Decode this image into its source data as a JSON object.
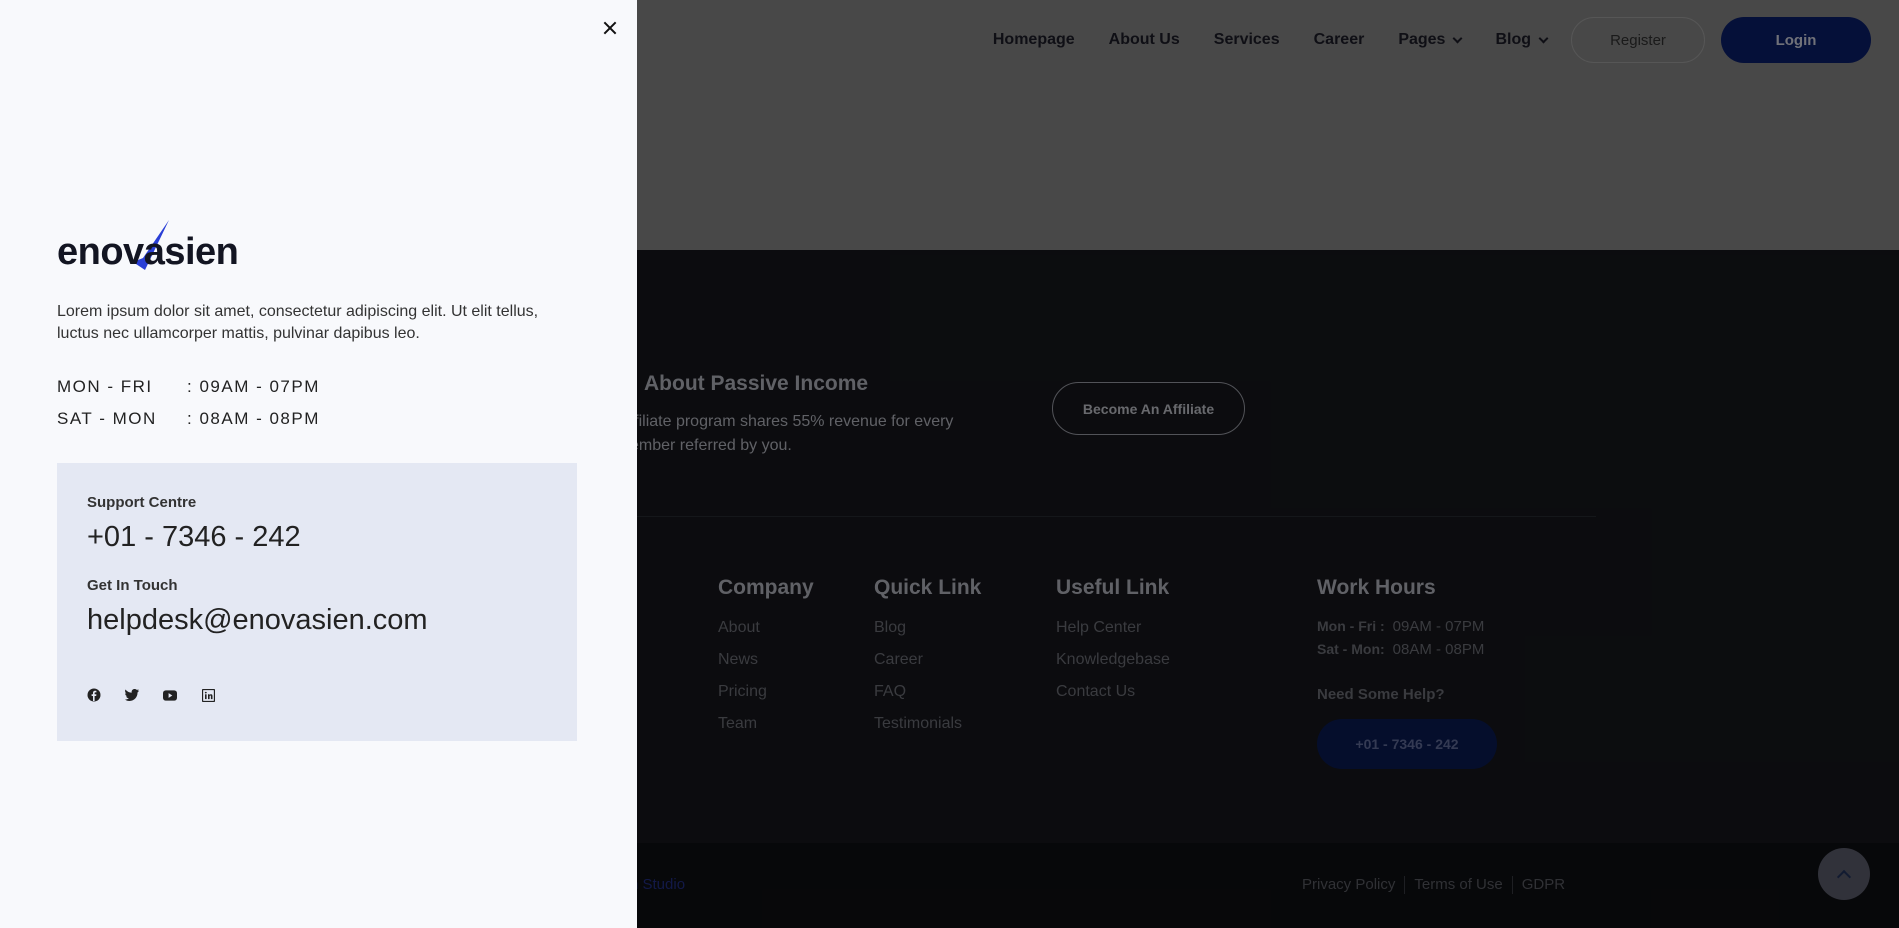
{
  "nav": {
    "items": [
      {
        "label": "Homepage",
        "dropdown": false
      },
      {
        "label": "About Us",
        "dropdown": false
      },
      {
        "label": "Services",
        "dropdown": false
      },
      {
        "label": "Career",
        "dropdown": false
      },
      {
        "label": "Pages",
        "dropdown": true
      },
      {
        "label": "Blog",
        "dropdown": true
      }
    ],
    "register_label": "Register",
    "login_label": "Login"
  },
  "affiliate": {
    "title": "About Passive Income",
    "text": "ffiliate program shares 55% revenue for every ember referred by you.",
    "button_label": "Become An Affiliate"
  },
  "footer": {
    "company": {
      "title": "Company",
      "links": [
        "About",
        "News",
        "Pricing",
        "Team"
      ]
    },
    "quick": {
      "title": "Quick Link",
      "links": [
        "Blog",
        "Career",
        "FAQ",
        "Testimonials"
      ]
    },
    "useful": {
      "title": "Useful Link",
      "links": [
        "Help Center",
        "Knowledgebase",
        "Contact Us"
      ]
    },
    "work_hours": {
      "title": "Work Hours",
      "rows": [
        {
          "day": "Mon - Fri :",
          "time": "09AM - 07PM"
        },
        {
          "day": "Sat - Mon:",
          "time": "08AM - 08PM"
        }
      ],
      "help_label": "Need Some Help?",
      "phone_button": "+01 - 7346 - 242"
    },
    "studio_text": "n Studio",
    "legal": [
      "Privacy Policy",
      "Terms of Use",
      "GDPR"
    ]
  },
  "panel": {
    "logo_text": "enovasien",
    "intro": "Lorem ipsum dolor sit amet, consectetur adipiscing elit. Ut elit tellus, luctus nec ullamcorper mattis, pulvinar dapibus leo.",
    "hours": [
      {
        "day": "MON - FRI",
        "time": ": 09AM - 07PM"
      },
      {
        "day": "SAT - MON",
        "time": ": 08AM - 08PM"
      }
    ],
    "support_label": "Support Centre",
    "support_phone": "+01 - 7346 - 242",
    "touch_label": "Get In Touch",
    "email": "helpdesk@enovasien.com",
    "socials": [
      "facebook-icon",
      "twitter-icon",
      "youtube-icon",
      "linkedin-icon"
    ]
  },
  "colors": {
    "brand_navy": "#0b1f6e",
    "panel_bg": "#f8f9fc",
    "contact_box_bg": "#e4e8f3",
    "logo_check": "#2a3fd6"
  }
}
